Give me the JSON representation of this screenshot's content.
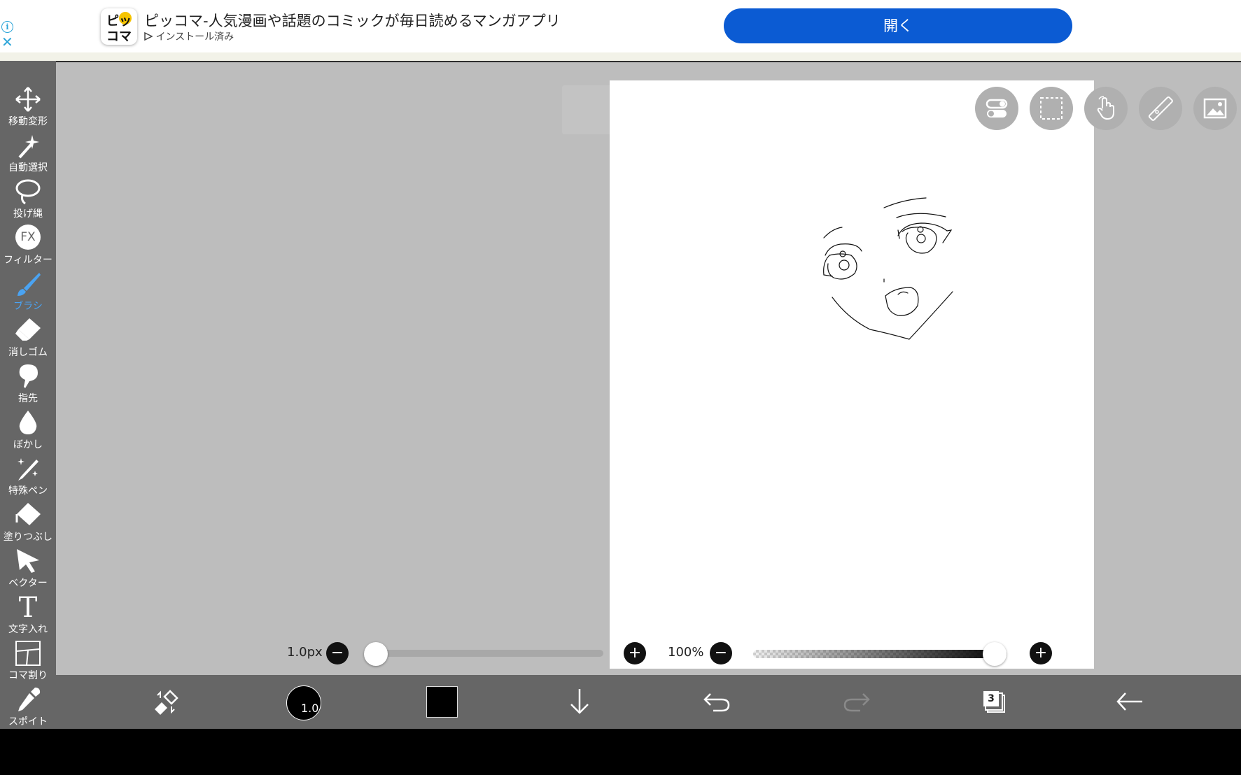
{
  "ad": {
    "title": "ピッコマ-人気漫画や話題のコミックが毎日読めるマンガアプリ",
    "subtitle": "インストール済み",
    "open_label": "開く",
    "logo_line1": "ピッ",
    "logo_line2": "コマ",
    "info_glyph": "i",
    "close_glyph": "✕"
  },
  "tools": [
    {
      "label": "移動変形",
      "icon": "move-icon"
    },
    {
      "label": "自動選択",
      "icon": "magic-wand-icon"
    },
    {
      "label": "投げ縄",
      "icon": "lasso-icon"
    },
    {
      "label": "フィルター",
      "icon": "fx-filter-icon"
    },
    {
      "label": "ブラシ",
      "icon": "brush-icon",
      "active": true
    },
    {
      "label": "消しゴム",
      "icon": "eraser-icon"
    },
    {
      "label": "指先",
      "icon": "finger-smudge-icon"
    },
    {
      "label": "ぼかし",
      "icon": "blur-drop-icon"
    },
    {
      "label": "特殊ペン",
      "icon": "special-pen-icon"
    },
    {
      "label": "塗りつぶし",
      "icon": "fill-bucket-icon"
    },
    {
      "label": "ベクター",
      "icon": "vector-arrow-icon"
    },
    {
      "label": "文字入れ",
      "icon": "text-icon"
    },
    {
      "label": "コマ割り",
      "icon": "panel-split-icon"
    },
    {
      "label": "スポイト",
      "icon": "eyedropper-icon"
    }
  ],
  "fx_text": "FX",
  "text_tool_glyph": "T",
  "brush": {
    "size_label": "1.0px",
    "size_badge": "1.0",
    "size_fraction": 0.0,
    "opacity_label": "100%",
    "opacity_fraction": 1.0
  },
  "buttons": {
    "minus": "−",
    "plus": "+"
  },
  "layer_count": "3",
  "colors": {
    "accent": "#4aa3f2",
    "ad_button": "#0b5bd3",
    "toolbar": "#666666",
    "workspace": "#bdbdbd",
    "current_color": "#000000"
  }
}
